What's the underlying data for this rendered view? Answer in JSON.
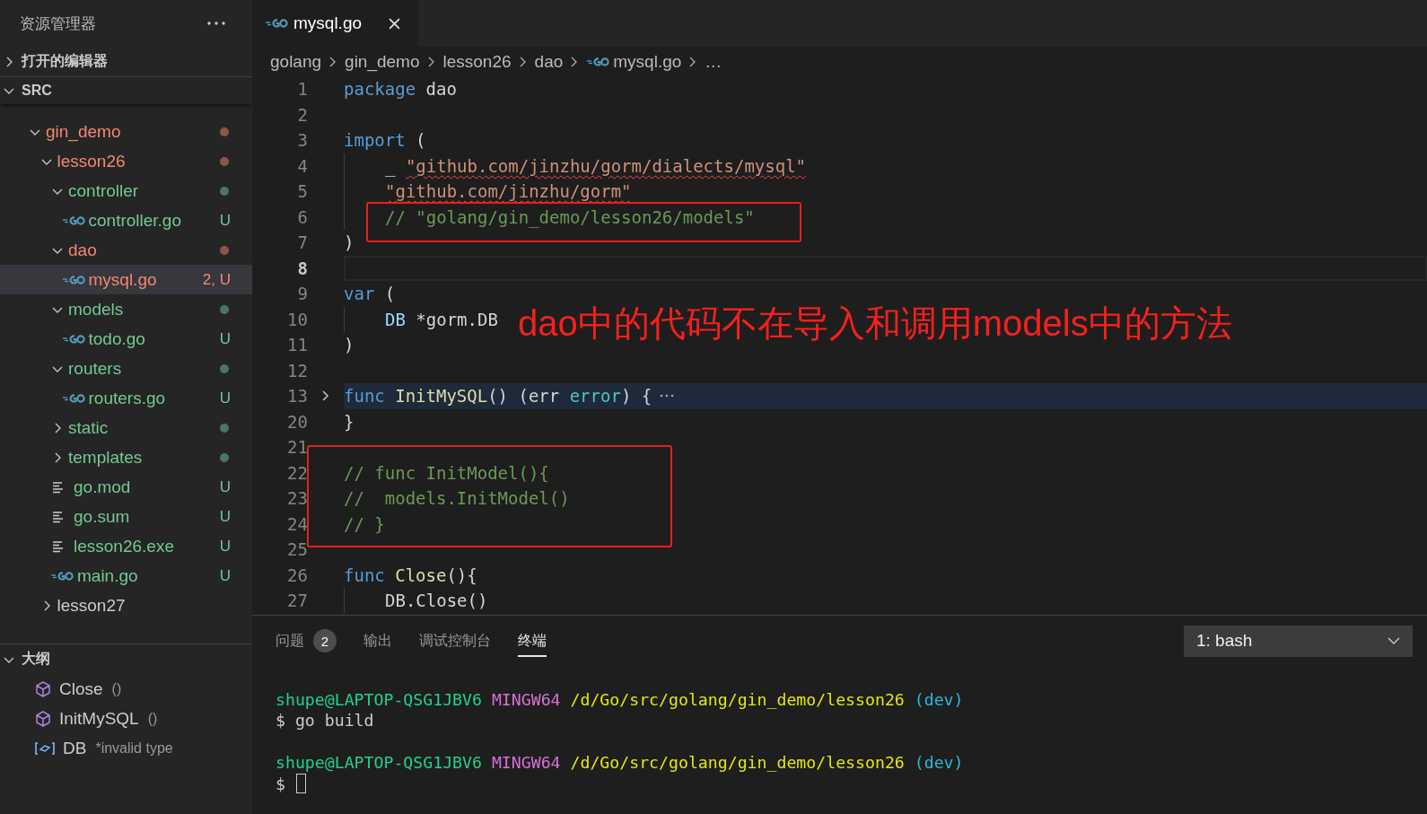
{
  "explorer": {
    "title": "资源管理器"
  },
  "open_editors": {
    "label": "打开的编辑器",
    "expanded": false
  },
  "src": {
    "label": "SRC",
    "expanded": true,
    "items": [
      {
        "name": "gin_demo",
        "kind": "folder",
        "expanded": true,
        "color": "#f48771",
        "dot": true,
        "selected": false,
        "children": [
          {
            "name": "lesson26",
            "kind": "folder",
            "expanded": true,
            "color": "#f48771",
            "dot": true,
            "selected": false,
            "children": [
              {
                "name": "controller",
                "kind": "folder",
                "expanded": true,
                "color": "#73c991",
                "dot": true,
                "selected": false,
                "children": [
                  {
                    "name": "controller.go",
                    "kind": "go",
                    "color": "#73c991",
                    "badge": "U",
                    "selected": false
                  }
                ]
              },
              {
                "name": "dao",
                "kind": "folder",
                "expanded": true,
                "color": "#f48771",
                "dot": true,
                "selected": false,
                "children": [
                  {
                    "name": "mysql.go",
                    "kind": "go",
                    "color": "#f48771",
                    "badge": "2, U",
                    "selected": true
                  }
                ]
              },
              {
                "name": "models",
                "kind": "folder",
                "expanded": true,
                "color": "#73c991",
                "dot": true,
                "selected": false,
                "children": [
                  {
                    "name": "todo.go",
                    "kind": "go",
                    "color": "#73c991",
                    "badge": "U",
                    "selected": false
                  }
                ]
              },
              {
                "name": "routers",
                "kind": "folder",
                "expanded": true,
                "color": "#73c991",
                "dot": true,
                "selected": false,
                "children": [
                  {
                    "name": "routers.go",
                    "kind": "go",
                    "color": "#73c991",
                    "badge": "U",
                    "selected": false
                  }
                ]
              },
              {
                "name": "static",
                "kind": "folder",
                "expanded": false,
                "color": "#73c991",
                "dot": true,
                "selected": false
              },
              {
                "name": "templates",
                "kind": "folder",
                "expanded": false,
                "color": "#73c991",
                "dot": true,
                "selected": false
              },
              {
                "name": "go.mod",
                "kind": "file",
                "color": "#73c991",
                "badge": "U",
                "selected": false
              },
              {
                "name": "go.sum",
                "kind": "file",
                "color": "#73c991",
                "badge": "U",
                "selected": false
              },
              {
                "name": "lesson26.exe",
                "kind": "file",
                "color": "#73c991",
                "badge": "U",
                "selected": false
              },
              {
                "name": "main.go",
                "kind": "go",
                "color": "#73c991",
                "badge": "U",
                "selected": false
              }
            ]
          },
          {
            "name": "lesson27",
            "kind": "folder",
            "expanded": false,
            "color": "#cccccc",
            "dot": false,
            "selected": false
          }
        ]
      }
    ]
  },
  "outline": {
    "label": "大纲",
    "expanded": true,
    "items": [
      {
        "kind": "method",
        "name": "Close",
        "detail": "()"
      },
      {
        "kind": "method",
        "name": "InitMySQL",
        "detail": "()"
      },
      {
        "kind": "variable",
        "name": "DB",
        "detail": "*invalid type"
      }
    ]
  },
  "tabs": [
    {
      "label": "mysql.go",
      "selected": true
    }
  ],
  "breadcrumb": [
    {
      "kind": "folder",
      "label": "golang"
    },
    {
      "kind": "folder",
      "label": "gin_demo"
    },
    {
      "kind": "folder",
      "label": "lesson26"
    },
    {
      "kind": "folder",
      "label": "dao"
    },
    {
      "kind": "go",
      "label": "mysql.go"
    },
    {
      "kind": "more",
      "label": "…"
    }
  ],
  "code": [
    {
      "num": "1",
      "current": false,
      "folded": false,
      "indent": false,
      "tokens": [
        {
          "kind": "kw",
          "text": "package "
        },
        {
          "kind": "plain",
          "text": "dao"
        }
      ]
    },
    {
      "num": "2",
      "current": false,
      "folded": false,
      "indent": false
    },
    {
      "num": "3",
      "current": false,
      "folded": false,
      "indent": false,
      "tokens": [
        {
          "kind": "kw",
          "text": "import "
        },
        {
          "kind": "plain",
          "text": "("
        }
      ]
    },
    {
      "num": "4",
      "current": false,
      "folded": false,
      "indent": true,
      "tokens": [
        {
          "kind": "plain",
          "text": "_ "
        },
        {
          "kind": "str",
          "text": "\"github.com/jinzhu/gorm/dialects/mysql\"",
          "error": true
        }
      ]
    },
    {
      "num": "5",
      "current": false,
      "folded": false,
      "indent": true,
      "tokens": [
        {
          "kind": "str",
          "text": "\"github.com/jinzhu/gorm\"",
          "error": true
        }
      ]
    },
    {
      "num": "6",
      "current": false,
      "folded": false,
      "indent": true,
      "tokens": [
        {
          "kind": "comment",
          "text": "// \"golang/gin_demo/lesson26/models\""
        }
      ]
    },
    {
      "num": "7",
      "current": false,
      "folded": false,
      "indent": false,
      "tokens": [
        {
          "kind": "plain",
          "text": ")"
        }
      ]
    },
    {
      "num": "8",
      "current": true,
      "folded": false,
      "indent": false
    },
    {
      "num": "9",
      "current": false,
      "folded": false,
      "indent": false,
      "tokens": [
        {
          "kind": "kw",
          "text": "var "
        },
        {
          "kind": "plain",
          "text": "("
        }
      ]
    },
    {
      "num": "10",
      "current": false,
      "folded": false,
      "indent": true,
      "tokens": [
        {
          "kind": "var",
          "text": "DB"
        },
        {
          "kind": "plain",
          "text": " *gorm.DB"
        }
      ]
    },
    {
      "num": "11",
      "current": false,
      "folded": false,
      "indent": false,
      "tokens": [
        {
          "kind": "plain",
          "text": ")"
        }
      ]
    },
    {
      "num": "12",
      "current": false,
      "folded": false,
      "indent": false
    },
    {
      "num": "13",
      "current": false,
      "folded": true,
      "indent": false,
      "tokens": [
        {
          "kind": "kw",
          "text": "func "
        },
        {
          "kind": "fn",
          "text": "InitMySQL"
        },
        {
          "kind": "plain",
          "text": "() (err "
        },
        {
          "kind": "type",
          "text": "error"
        },
        {
          "kind": "plain",
          "text": ") {"
        }
      ]
    },
    {
      "num": "20",
      "current": false,
      "folded": false,
      "indent": false,
      "tokens": [
        {
          "kind": "plain",
          "text": "}"
        }
      ]
    },
    {
      "num": "21",
      "current": false,
      "folded": false,
      "indent": false
    },
    {
      "num": "22",
      "current": false,
      "folded": false,
      "indent": false,
      "tokens": [
        {
          "kind": "comment",
          "text": "// func InitModel(){"
        }
      ]
    },
    {
      "num": "23",
      "current": false,
      "folded": false,
      "indent": false,
      "tokens": [
        {
          "kind": "comment",
          "text": "//  models.InitModel()"
        }
      ]
    },
    {
      "num": "24",
      "current": false,
      "folded": false,
      "indent": false,
      "tokens": [
        {
          "kind": "comment",
          "text": "// }"
        }
      ]
    },
    {
      "num": "25",
      "current": false,
      "folded": false,
      "indent": false
    },
    {
      "num": "26",
      "current": false,
      "folded": false,
      "indent": false,
      "tokens": [
        {
          "kind": "kw",
          "text": "func "
        },
        {
          "kind": "fn",
          "text": "Close"
        },
        {
          "kind": "plain",
          "text": "(){"
        }
      ]
    },
    {
      "num": "27",
      "current": false,
      "folded": false,
      "indent": true,
      "tokens": [
        {
          "kind": "plain",
          "text": "DB.Close()"
        }
      ]
    }
  ],
  "annotations": [
    {
      "kind": "box"
    },
    {
      "kind": "box"
    },
    {
      "kind": "note",
      "text": "dao中的代码不在导入和调用models中的方法"
    }
  ],
  "panel": {
    "tabs": [
      {
        "label": "问题",
        "count": "2",
        "selected": false
      },
      {
        "label": "输出",
        "selected": false
      },
      {
        "label": "调试控制台",
        "selected": false
      },
      {
        "label": "终端",
        "selected": true
      }
    ],
    "terminal_select": "1: bash",
    "terminal": [
      {
        "kind": "blank"
      },
      {
        "kind": "text",
        "segments": [
          {
            "kind": "user",
            "text": "shupe@LAPTOP-QSG1JBV6"
          },
          {
            "kind": "host",
            "text": "MINGW64"
          },
          {
            "kind": "path",
            "text": "/d/Go/src/golang/gin_demo/lesson26"
          },
          {
            "kind": "branch",
            "text": "(dev)"
          }
        ]
      },
      {
        "kind": "text",
        "segments": [
          {
            "kind": "plain",
            "text": "$ go build"
          }
        ]
      },
      {
        "kind": "blank"
      },
      {
        "kind": "text",
        "segments": [
          {
            "kind": "user",
            "text": "shupe@LAPTOP-QSG1JBV6"
          },
          {
            "kind": "host",
            "text": "MINGW64"
          },
          {
            "kind": "path",
            "text": "/d/Go/src/golang/gin_demo/lesson26"
          },
          {
            "kind": "branch",
            "text": "(dev)"
          }
        ]
      },
      {
        "kind": "text",
        "cursor": true,
        "segments": [
          {
            "kind": "plain",
            "text": "$"
          }
        ]
      }
    ]
  }
}
